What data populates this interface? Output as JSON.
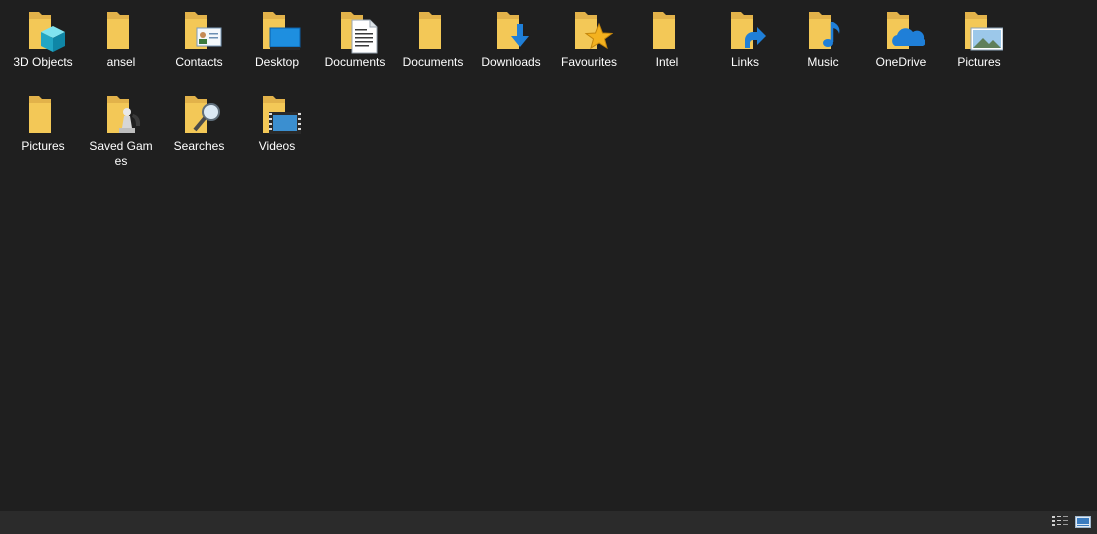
{
  "folders": [
    {
      "label": "3D Objects",
      "icon": "3d-objects-icon"
    },
    {
      "label": "ansel",
      "icon": "folder-icon"
    },
    {
      "label": "Contacts",
      "icon": "contacts-icon"
    },
    {
      "label": "Desktop",
      "icon": "desktop-icon"
    },
    {
      "label": "Documents",
      "icon": "documents-icon"
    },
    {
      "label": "Documents",
      "icon": "folder-icon"
    },
    {
      "label": "Downloads",
      "icon": "downloads-icon"
    },
    {
      "label": "Favourites",
      "icon": "favourites-icon"
    },
    {
      "label": "Intel",
      "icon": "folder-icon"
    },
    {
      "label": "Links",
      "icon": "links-icon"
    },
    {
      "label": "Music",
      "icon": "music-icon"
    },
    {
      "label": "OneDrive",
      "icon": "onedrive-icon"
    },
    {
      "label": "Pictures",
      "icon": "pictures-icon"
    },
    {
      "label": "Pictures",
      "icon": "folder-icon"
    },
    {
      "label": "Saved Games",
      "icon": "saved-games-icon"
    },
    {
      "label": "Searches",
      "icon": "searches-icon"
    },
    {
      "label": "Videos",
      "icon": "videos-icon"
    }
  ],
  "statusbar": {
    "details_view": "details-view-icon",
    "large_icons_view": "large-icons-view-icon"
  },
  "colors": {
    "background": "#1f1f1f",
    "folder": "#f3c857",
    "text": "#ffffff"
  }
}
